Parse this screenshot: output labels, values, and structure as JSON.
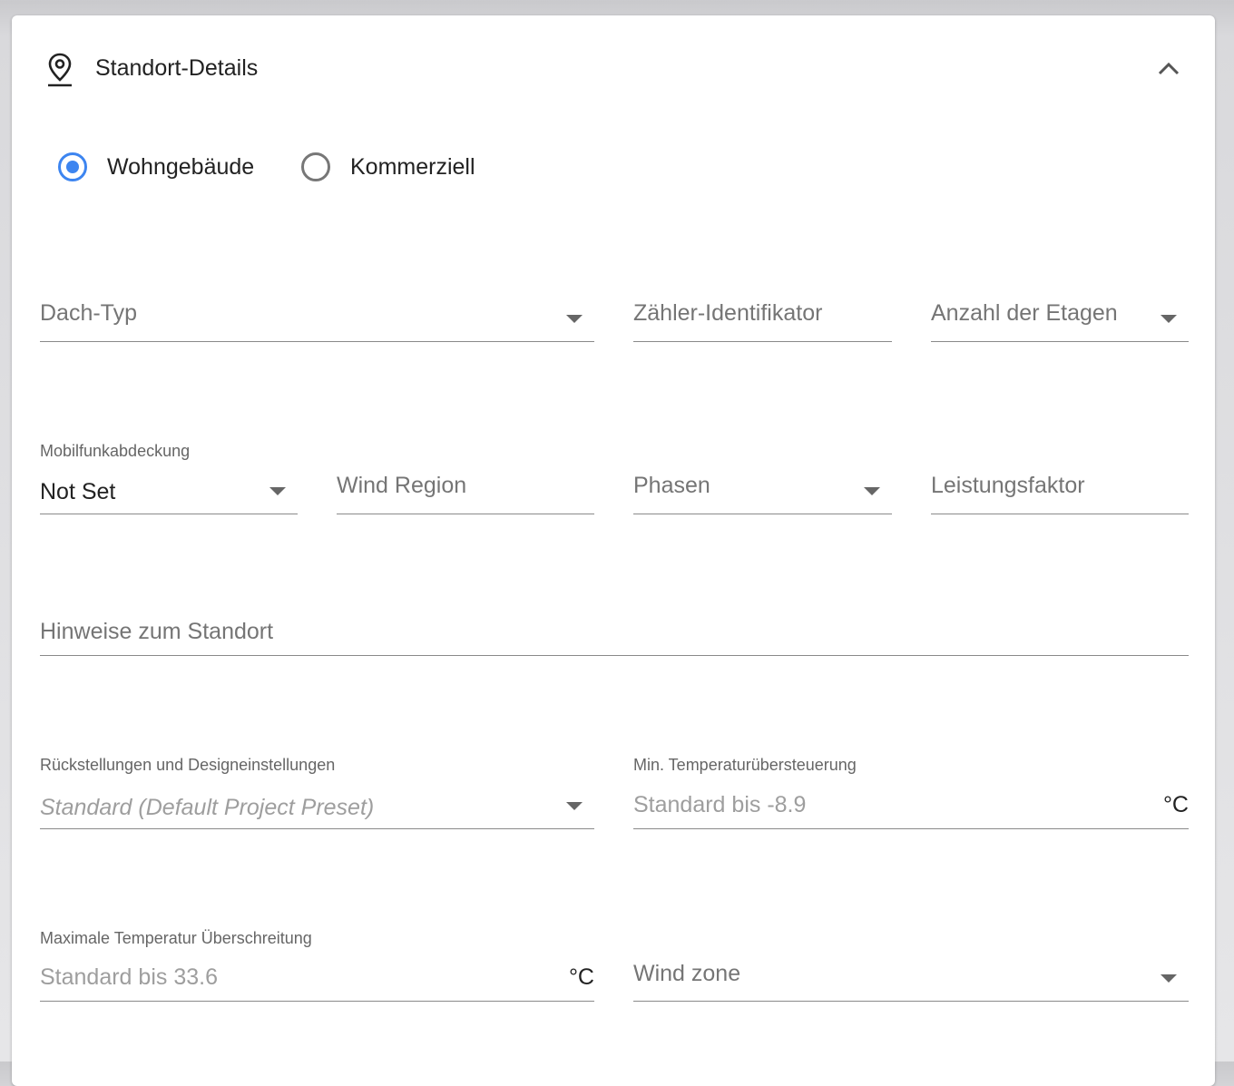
{
  "header": {
    "title": "Standort-Details"
  },
  "site_type": {
    "options": [
      "Wohngebäude",
      "Kommerziell"
    ],
    "selected": "Wohngebäude"
  },
  "fields": {
    "roof_type": {
      "placeholder": "Dach-Typ"
    },
    "meter_id": {
      "placeholder": "Zähler-Identifikator"
    },
    "floors": {
      "placeholder": "Anzahl der Etagen"
    },
    "cell_coverage": {
      "label": "Mobilfunkabdeckung",
      "value": "Not Set"
    },
    "wind_region": {
      "placeholder": "Wind Region"
    },
    "phases": {
      "placeholder": "Phasen"
    },
    "power_factor": {
      "placeholder": "Leistungsfaktor"
    },
    "site_notes": {
      "placeholder": "Hinweise zum Standort"
    },
    "setbacks": {
      "label": "Rückstellungen und Designeinstellungen",
      "hint": "Standard (Default Project Preset)"
    },
    "min_temp": {
      "label": "Min. Temperaturübersteuerung",
      "hint": "Standard bis -8.9",
      "unit": "°C"
    },
    "max_temp": {
      "label": "Maximale Temperatur Überschreitung",
      "hint": "Standard bis 33.6",
      "unit": "°C"
    },
    "wind_zone": {
      "placeholder": "Wind zone"
    }
  },
  "icons": {
    "header": "location-pin-icon",
    "collapse": "chevron-up-icon"
  },
  "colors": {
    "accent": "#3d85f0"
  }
}
